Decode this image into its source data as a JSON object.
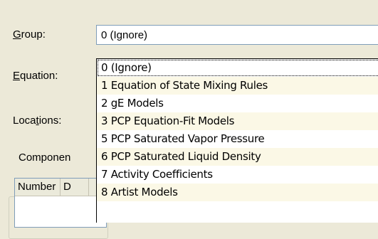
{
  "form": {
    "group_label_mnemonic": "G",
    "group_label_rest": "roup:",
    "equation_label_mnemonic": "E",
    "equation_label_rest": "quation:",
    "locations_label_pre": "Loca",
    "locations_label_mnemonic": "t",
    "locations_label_post": "ions:"
  },
  "group_combo": {
    "selected_value": "0 (Ignore)"
  },
  "dropdown": {
    "options": [
      "0 (Ignore)",
      "1 Equation of State Mixing Rules",
      "2 gE Models",
      "3 PCP Equation-Fit Models",
      "5 PCP Saturated Vapor Pressure",
      "6 PCP Saturated Liquid Density",
      "7 Activity Coefficients",
      "8 Artist Models"
    ]
  },
  "components": {
    "caption": "Componen",
    "columns": [
      "Number",
      "D"
    ]
  }
}
